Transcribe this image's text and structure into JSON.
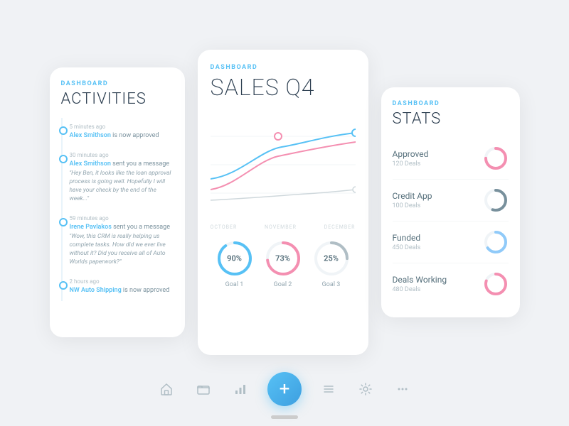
{
  "cards": {
    "activities": {
      "label": "DASHBOARD",
      "title": "ACTIVITIES",
      "items": [
        {
          "time": "5 minutes ago",
          "text_pre": "",
          "link": "Alex Smithson",
          "text_post": " is now approved",
          "quote": ""
        },
        {
          "time": "30 minutes ago",
          "text_pre": "",
          "link": "Alex Smithson",
          "text_post": " sent you a message",
          "quote": "\"Hey Ben, it looks like the loan approval process is going well. Hopefully I will have your check by the end of the week...\""
        },
        {
          "time": "59 minutes ago",
          "text_pre": "",
          "link": "Irene Pavlakos",
          "text_post": " sent you a message",
          "quote": "\"Wow, this CRM is really helping us complete tasks.  How did we ever live without it?  Did you receive all of Auto Worlds paperwork?\""
        },
        {
          "time": "2 hours ago",
          "text_pre": "",
          "link": "NW Auto Shipping",
          "text_post": " is now approved",
          "quote": ""
        }
      ]
    },
    "sales": {
      "label": "DASHBOARD",
      "title": "SALES Q4",
      "chart_labels": [
        "OCTOBER",
        "NOVEMBER",
        "DECEMBER"
      ],
      "goals": [
        {
          "label": "Goal 1",
          "pct": "90%",
          "value": 90,
          "color": "#57c1f5"
        },
        {
          "label": "Goal 2",
          "pct": "73%",
          "value": 73,
          "color": "#f48fb1"
        },
        {
          "label": "Goal 3",
          "pct": "25%",
          "value": 25,
          "color": "#b0bec5"
        }
      ]
    },
    "stats": {
      "label": "DASHBOARD",
      "title": "STATS",
      "items": [
        {
          "name": "Approved",
          "deals": "120 Deals",
          "pct": 75,
          "color1": "#f48fb1",
          "color2": "#ef9a9a"
        },
        {
          "name": "Credit App",
          "deals": "100 Deals",
          "pct": 55,
          "color1": "#78909c",
          "color2": "#b0bec5"
        },
        {
          "name": "Funded",
          "deals": "450 Deals",
          "pct": 65,
          "color1": "#90caf9",
          "color2": "#64b5f6"
        },
        {
          "name": "Deals Working",
          "deals": "480 Deals",
          "pct": 80,
          "color1": "#f48fb1",
          "color2": "#f06292"
        }
      ]
    }
  },
  "nav": {
    "icons": [
      "⌂",
      "⊞",
      "▦",
      "+",
      "≡",
      "⚙",
      "···"
    ]
  }
}
